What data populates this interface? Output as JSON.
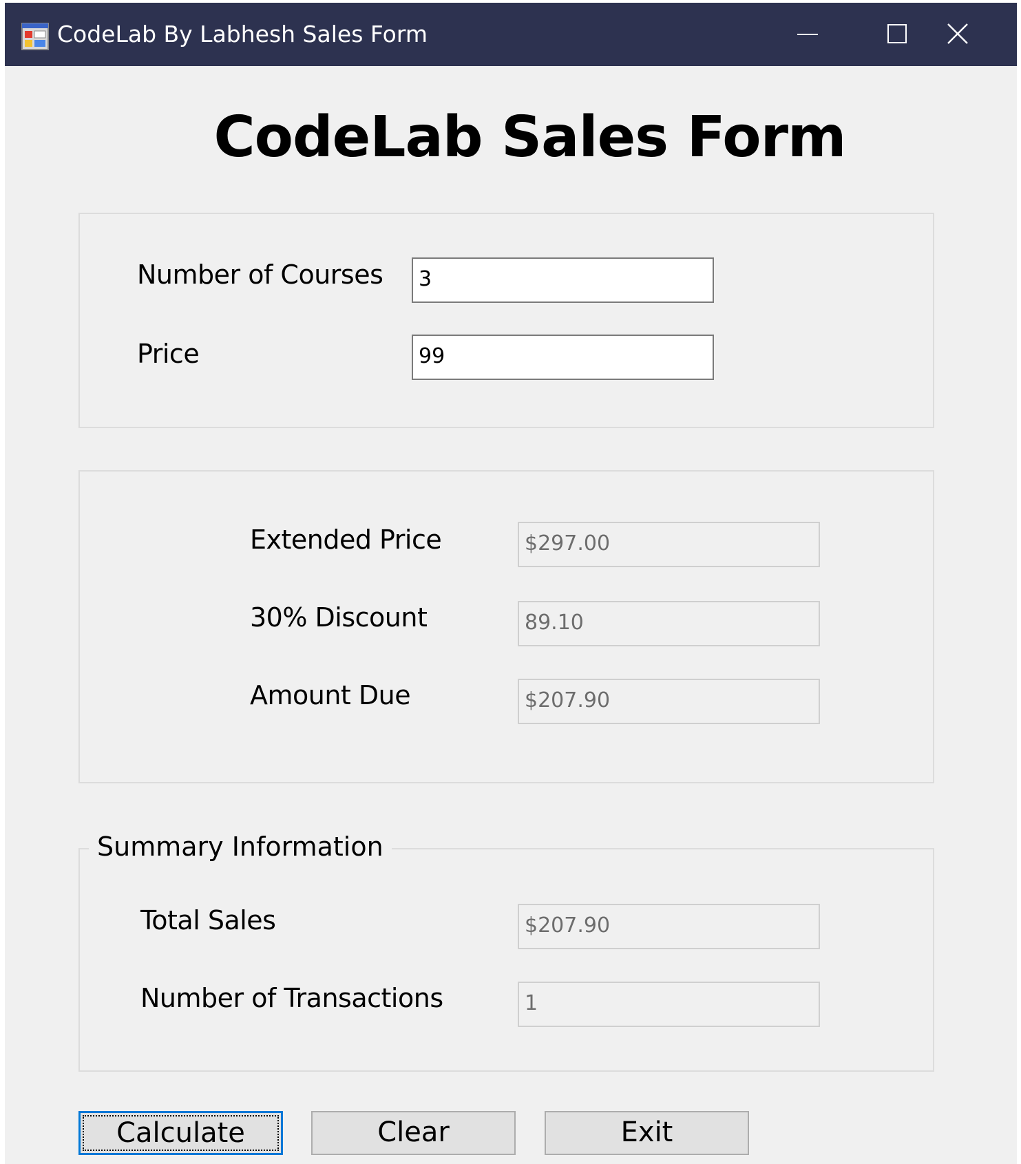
{
  "window": {
    "title": "CodeLab By Labhesh Sales Form",
    "icon": "application-icon",
    "controls": {
      "minimize": "minimize-icon",
      "maximize": "maximize-icon",
      "close": "close-icon"
    },
    "titlebar_color": "#2d3250"
  },
  "heading": "CodeLab Sales Form",
  "input_group": {
    "courses_label": "Number of Courses",
    "courses_value": "3",
    "price_label": "Price",
    "price_value": "99"
  },
  "results_group": {
    "extended_price_label": "Extended Price",
    "extended_price_value": "$297.00",
    "discount_label": "30% Discount",
    "discount_value": "89.10",
    "amount_due_label": "Amount Due",
    "amount_due_value": "$207.90"
  },
  "summary_group": {
    "legend": "Summary Information",
    "total_sales_label": "Total Sales",
    "total_sales_value": "$207.90",
    "transactions_label": "Number of Transactions",
    "transactions_value": "1"
  },
  "buttons": {
    "calculate": "Calculate",
    "clear": "Clear",
    "exit": "Exit"
  },
  "colors": {
    "focus_accent": "#0078d7",
    "form_background": "#f0f0f0"
  }
}
